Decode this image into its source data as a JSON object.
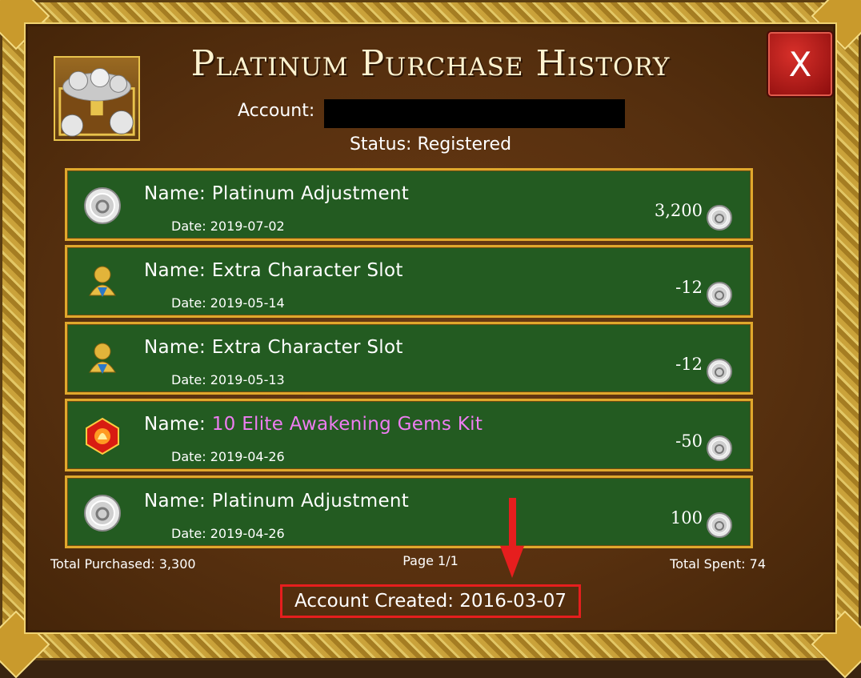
{
  "window": {
    "title": "Platinum Purchase History",
    "close_label": "X"
  },
  "account": {
    "label": "Account:",
    "value_redacted": true
  },
  "status": "Status: Registered",
  "entries": [
    {
      "icon": "platinum-coin-icon",
      "name_prefix": "Name: ",
      "name": "Platinum Adjustment",
      "highlight": false,
      "date": "Date: 2019-07-02",
      "amount": "3,200"
    },
    {
      "icon": "character-slot-icon",
      "name_prefix": "Name: ",
      "name": "Extra Character Slot",
      "highlight": false,
      "date": "Date: 2019-05-14",
      "amount": "-12"
    },
    {
      "icon": "character-slot-icon",
      "name_prefix": "Name: ",
      "name": "Extra Character Slot",
      "highlight": false,
      "date": "Date: 2019-05-13",
      "amount": "-12"
    },
    {
      "icon": "awakening-gem-icon",
      "name_prefix": "Name: ",
      "name": "10 Elite Awakening Gems Kit",
      "highlight": true,
      "date": "Date: 2019-04-26",
      "amount": "-50"
    },
    {
      "icon": "platinum-coin-icon",
      "name_prefix": "Name: ",
      "name": "Platinum Adjustment",
      "highlight": false,
      "date": "Date: 2019-04-26",
      "amount": "100"
    }
  ],
  "footer": {
    "total_purchased": "Total Purchased: 3,300",
    "page": "Page 1/1",
    "total_spent": "Total Spent: 74",
    "account_created": "Account Created: 2016-03-07"
  },
  "colors": {
    "row_bg": "#235b21",
    "row_border": "#e0a82c",
    "highlight_name": "#ee7df2",
    "annotation_red": "#e61e1e"
  }
}
